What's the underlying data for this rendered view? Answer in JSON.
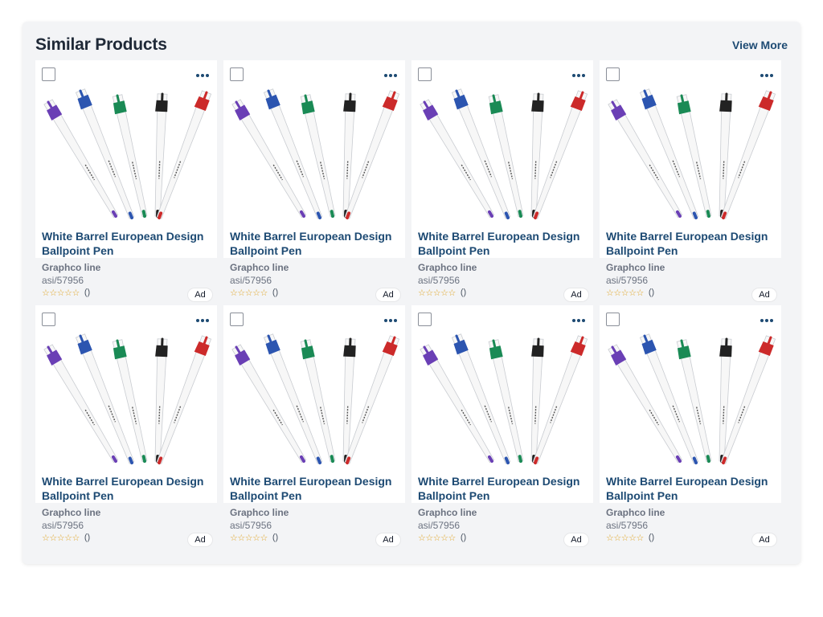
{
  "section": {
    "title": "Similar Products",
    "view_more_label": "View More"
  },
  "colors": {
    "accent": "#1d4a73",
    "star": "#e0a526",
    "pen_colors": [
      "#6a3fb5",
      "#2c55b0",
      "#1a8a55",
      "#222222",
      "#cc2a2a"
    ]
  },
  "products": [
    {
      "name": "White Barrel European Design Ballpoint Pen",
      "supplier": "Graphco line",
      "asi": "asi/57956",
      "stars": "☆☆☆☆☆",
      "review_count": "()",
      "ad_label": "Ad"
    },
    {
      "name": "White Barrel European Design Ballpoint Pen",
      "supplier": "Graphco line",
      "asi": "asi/57956",
      "stars": "☆☆☆☆☆",
      "review_count": "()",
      "ad_label": "Ad"
    },
    {
      "name": "White Barrel European Design Ballpoint Pen",
      "supplier": "Graphco line",
      "asi": "asi/57956",
      "stars": "☆☆☆☆☆",
      "review_count": "()",
      "ad_label": "Ad"
    },
    {
      "name": "White Barrel European Design Ballpoint Pen",
      "supplier": "Graphco line",
      "asi": "asi/57956",
      "stars": "☆☆☆☆☆",
      "review_count": "()",
      "ad_label": "Ad"
    },
    {
      "name": "White Barrel European Design Ballpoint Pen",
      "supplier": "Graphco line",
      "asi": "asi/57956",
      "stars": "☆☆☆☆☆",
      "review_count": "()",
      "ad_label": "Ad"
    },
    {
      "name": "White Barrel European Design Ballpoint Pen",
      "supplier": "Graphco line",
      "asi": "asi/57956",
      "stars": "☆☆☆☆☆",
      "review_count": "()",
      "ad_label": "Ad"
    },
    {
      "name": "White Barrel European Design Ballpoint Pen",
      "supplier": "Graphco line",
      "asi": "asi/57956",
      "stars": "☆☆☆☆☆",
      "review_count": "()",
      "ad_label": "Ad"
    },
    {
      "name": "White Barrel European Design Ballpoint Pen",
      "supplier": "Graphco line",
      "asi": "asi/57956",
      "stars": "☆☆☆☆☆",
      "review_count": "()",
      "ad_label": "Ad"
    }
  ]
}
